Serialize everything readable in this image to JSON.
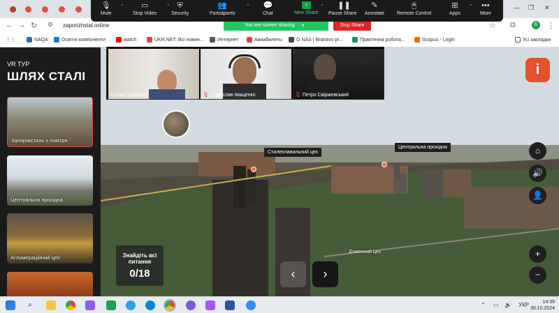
{
  "zoom_toolbar": {
    "buttons": [
      {
        "label": "Mute",
        "icon": "microphone-icon"
      },
      {
        "label": "Stop Video",
        "icon": "video-camera-icon"
      },
      {
        "label": "Security",
        "icon": "shield-icon"
      },
      {
        "label": "Participants",
        "icon": "participants-icon",
        "count": "3"
      },
      {
        "label": "Chat",
        "icon": "chat-icon"
      },
      {
        "label": "New Share",
        "icon": "share-arrow-icon"
      },
      {
        "label": "Pause Share",
        "icon": "pause-icon"
      },
      {
        "label": "Annotate",
        "icon": "pen-icon"
      },
      {
        "label": "Remote Control",
        "icon": "mouse-icon"
      },
      {
        "label": "Apps",
        "icon": "apps-icon"
      },
      {
        "label": "More",
        "icon": "ellipsis-icon"
      }
    ],
    "sharing_banner": "You are screen sharing",
    "stop_share": "Stop Share"
  },
  "browser": {
    "url": "zaporizhstal.online",
    "profile_initial": "Б",
    "bookmarks": [
      {
        "label": "NAQA",
        "color": "#2b6cb0"
      },
      {
        "label": "Освітні компоненти",
        "color": "#1a73e8"
      },
      {
        "label": "watch",
        "color": "#ff0000"
      },
      {
        "label": "UKR.NET: Всі новин...",
        "color": "#e53e3e"
      },
      {
        "label": "Интернет",
        "color": "#555555"
      },
      {
        "label": "Авиабилеты",
        "color": "#e53e3e"
      },
      {
        "label": "О NÁS | Bratstvo pr...",
        "color": "#444444"
      },
      {
        "label": "Практична робота...",
        "color": "#0f9d58"
      },
      {
        "label": "Scopus - Login",
        "color": "#e37400"
      },
      {
        "label": "Усі закладки",
        "color": "#555555"
      }
    ]
  },
  "sidebar": {
    "vr_label": "VR ТУР",
    "brand": "ШЛЯХ СТАЛІ",
    "cards": [
      {
        "label": "Запоріжсталь з повітря"
      },
      {
        "label": "Центральна прохідна"
      },
      {
        "label": "Агломераційний цех"
      },
      {
        "label": ""
      }
    ]
  },
  "participants": [
    {
      "name": "Богдан Цимбал",
      "muted": false
    },
    {
      "name": "Станіслав Іващенко",
      "muted": true
    },
    {
      "name": "Петро Свіржевський",
      "muted": true
    }
  ],
  "scene": {
    "hotspots": [
      {
        "label": "Сталеплавильний цех"
      },
      {
        "label": "Центральна прохідна"
      },
      {
        "label": "Доменний цех"
      }
    ],
    "counter_title": "Знайдіть всі питання",
    "counter_value": "0/18",
    "info_label": "i"
  },
  "taskbar": {
    "time": "14:39",
    "date": "30.10.2024",
    "lang": "УКР"
  },
  "colors": {
    "accent": "#e2522b",
    "share_green": "#22c55e",
    "stop_red": "#dc2626"
  }
}
